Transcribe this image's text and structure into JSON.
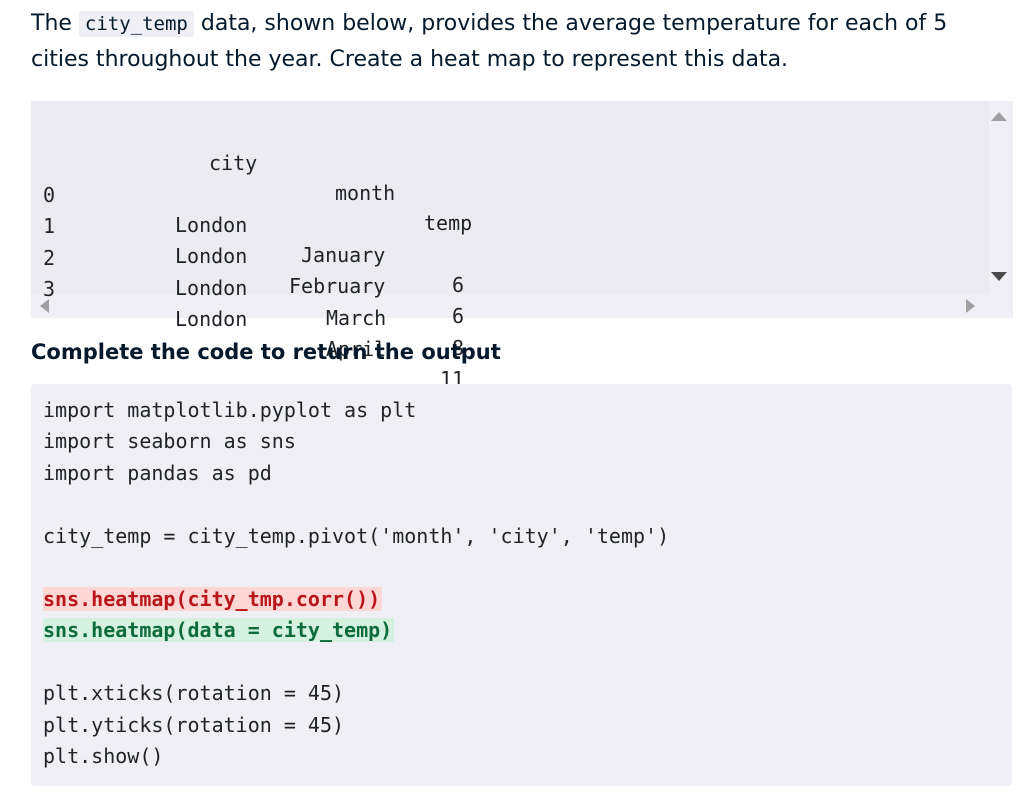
{
  "prompt": {
    "before": "The ",
    "code": "city_temp",
    "line1_rest": " data, shown below, provides the average temperature for each of 5",
    "line2": "cities throughout the year. Create a heat map to represent this data."
  },
  "dataframe": {
    "columns": [
      "city",
      "month",
      "temp"
    ],
    "rows": [
      {
        "index": "0",
        "city": "London",
        "month": "January",
        "temp": "6"
      },
      {
        "index": "1",
        "city": "London",
        "month": "February",
        "temp": "6"
      },
      {
        "index": "2",
        "city": "London",
        "month": "March",
        "temp": "8"
      },
      {
        "index": "3",
        "city": "London",
        "month": "April",
        "temp": "11"
      }
    ]
  },
  "heading": "Complete the code to return the output",
  "code": {
    "import1": "import matplotlib.pyplot as plt",
    "import2": "import seaborn as sns",
    "import3": "import pandas as pd",
    "pivot": "city_temp = city_temp.pivot('month', 'city', 'temp')",
    "removed": "sns.heatmap(city_tmp.corr())",
    "added": "sns.heatmap(data = city_temp)",
    "xticks": "plt.xticks(rotation = 45)",
    "yticks": "plt.yticks(rotation = 45)",
    "show": "plt.show()"
  },
  "colors": {
    "removed_bg": "#fdd7d4",
    "removed_text": "#b8161a",
    "added_bg": "#d4f2df",
    "added_text": "#0e6b3a"
  },
  "icons": [
    "scroll-up-arrow-icon",
    "scroll-down-arrow-icon",
    "scroll-left-arrow-icon",
    "scroll-right-arrow-icon"
  ]
}
